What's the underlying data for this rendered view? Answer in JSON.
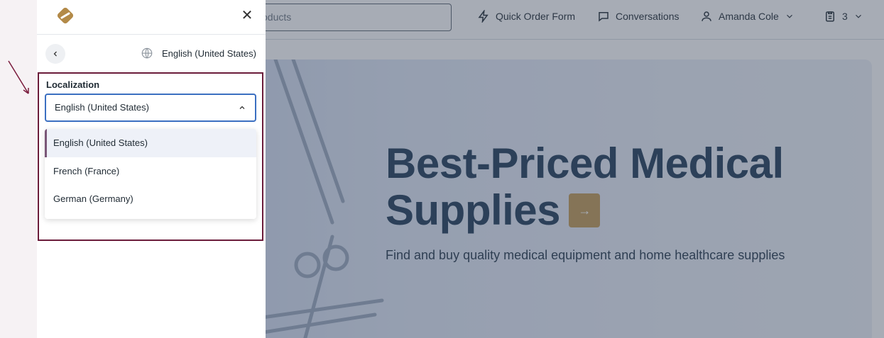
{
  "header": {
    "search_placeholder": "oducts",
    "quick_order_label": "Quick Order Form",
    "conversations_label": "Conversations",
    "user_name": "Amanda Cole",
    "cart_count": "3"
  },
  "hero": {
    "title_line1": "Best-Priced Medical",
    "title_line2": "Supplies",
    "subtitle": "Find and buy quality medical equipment and home healthcare supplies",
    "arrow_glyph": "→"
  },
  "drawer": {
    "close_glyph": "✕",
    "current_language": "English (United States)",
    "localization_label": "Localization",
    "selected_value": "English (United States)",
    "options": [
      {
        "label": "English (United States)",
        "selected": true
      },
      {
        "label": "French (France)",
        "selected": false
      },
      {
        "label": "German (Germany)",
        "selected": false
      }
    ]
  },
  "colors": {
    "accent": "#c19a55",
    "focus_border": "#3b6fc1",
    "highlight_border": "#6b1c3a"
  }
}
